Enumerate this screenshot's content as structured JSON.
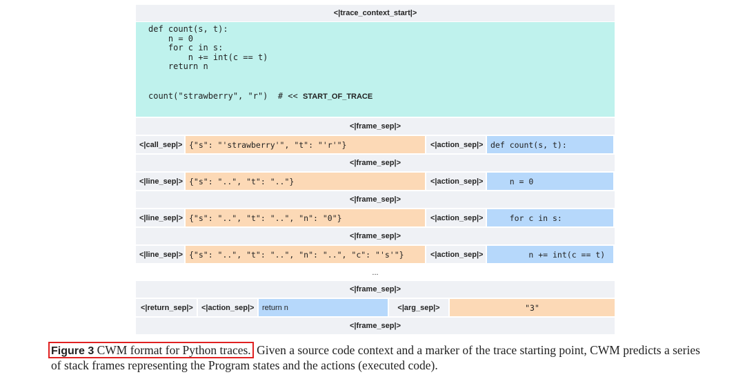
{
  "figure": {
    "trace_context_start": "<|trace_context_start|>",
    "code_lines": "def count(s, t):\n    n = 0\n    for c in s:\n        n += int(c == t)\n    return n",
    "start_call": "count(\"strawberry\", \"r\")  # << ",
    "start_marker": "START_OF_TRACE",
    "frame_sep": "<|frame_sep|>",
    "rows": [
      {
        "sep": "<|call_sep|>",
        "state": "{\"s\": \"'strawberry'\", \"t\": \"'r'\"}",
        "action_sep": "<|action_sep|>",
        "action": "def count(s, t):"
      },
      {
        "sep": "<|line_sep|>",
        "state": "{\"s\": \"..\", \"t\": \"..\"}",
        "action_sep": "<|action_sep|>",
        "action": "    n = 0"
      },
      {
        "sep": "<|line_sep|>",
        "state": "{\"s\": \"..\", \"t\": \"..\", \"n\": \"0\"}",
        "action_sep": "<|action_sep|>",
        "action": "    for c in s:"
      },
      {
        "sep": "<|line_sep|>",
        "state": "{\"s\": \"..\", \"t\": \"..\", \"n\": \"..\", \"c\": \"'s'\"}",
        "action_sep": "<|action_sep|>",
        "action": "        n += int(c == t)"
      }
    ],
    "ellipsis": "...",
    "return_row": {
      "return_sep": "<|return_sep|>",
      "action_sep": "<|action_sep|>",
      "action": "return n",
      "arg_sep": "<|arg_sep|>",
      "arg": "\"3\""
    }
  },
  "caption": {
    "label": "Figure 3",
    "title": " CWM format for Python traces.",
    "text": " Given a source code context and a marker of the trace starting point, CWM predicts a series of stack frames representing the Program states and the actions (executed code)."
  }
}
